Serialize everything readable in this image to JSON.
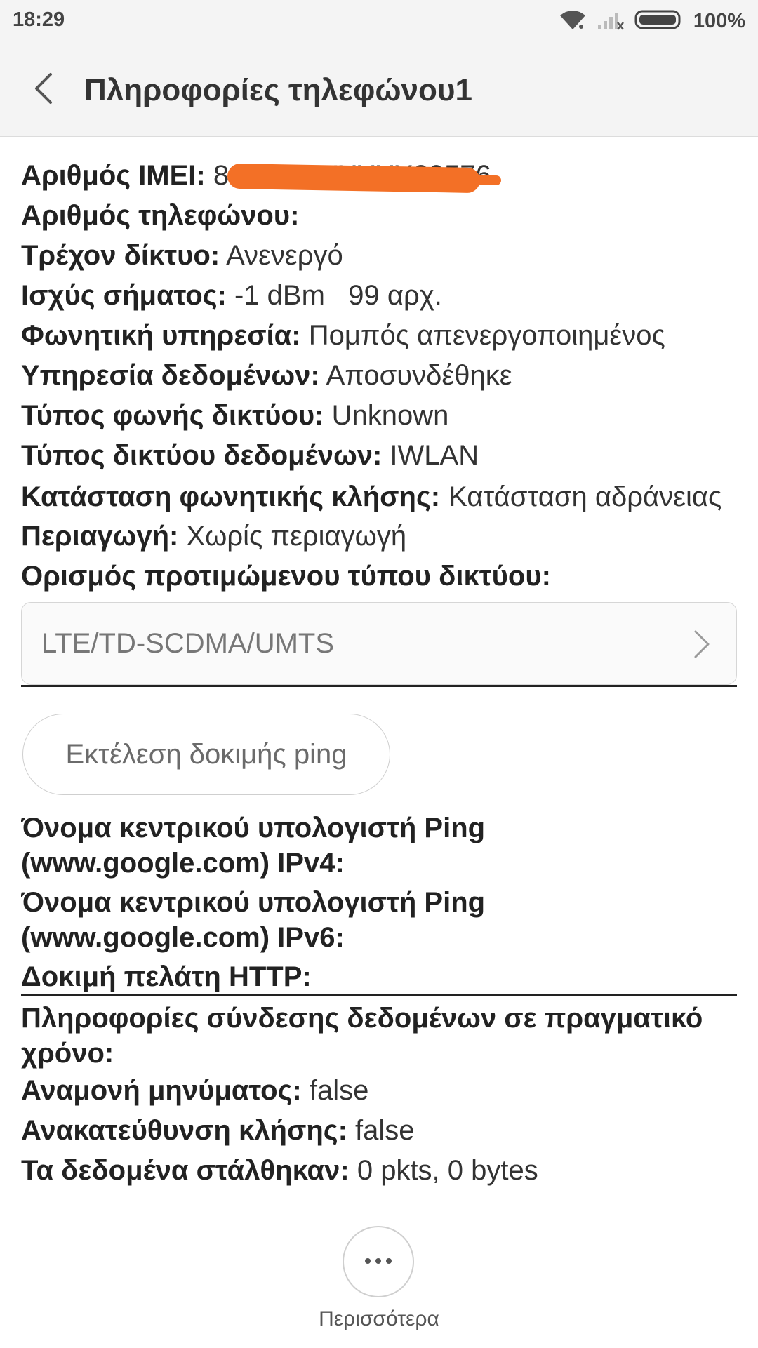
{
  "status_bar": {
    "time": "18:29",
    "battery": "100%",
    "icons": [
      "wifi-icon",
      "signal-icon",
      "battery-icon"
    ]
  },
  "header": {
    "title": "Πληροφορίες τηλεφώνου1",
    "back_icon": "chevron-left-icon"
  },
  "info": {
    "imei": {
      "label": "Αριθμός IMEI:",
      "value": "86XXXXXXXXX29576"
    },
    "phone_number": {
      "label": "Αριθμός τηλεφώνου:",
      "value": ""
    },
    "current_network": {
      "label": "Τρέχον δίκτυο:",
      "value": "Ανενεργό"
    },
    "signal_strength": {
      "label": "Ισχύς σήματος:",
      "value": "-1 dBm   99 αρχ."
    },
    "voice_service": {
      "label": "Φωνητική υπηρεσία:",
      "value": "Πομπός απενεργοποιημένος"
    },
    "data_service": {
      "label": "Υπηρεσία δεδομένων:",
      "value": "Αποσυνδέθηκε"
    },
    "voice_network_type": {
      "label": "Τύπος φωνής δικτύου:",
      "value": "Unknown"
    },
    "data_network_type": {
      "label": "Τύπος δικτύου δεδομένων:",
      "value": "IWLAN"
    },
    "voice_call_status": {
      "label": "Κατάσταση φωνητικής κλήσης:",
      "value": "Κατάσταση αδράνειας"
    },
    "roaming": {
      "label": "Περιαγωγή:",
      "value": "Χωρίς περιαγωγή"
    },
    "preferred_network": {
      "label": "Ορισμός προτιμώμενου τύπου δικτύου:"
    }
  },
  "network_select": {
    "value": "LTE/TD-SCDMA/UMTS"
  },
  "ping": {
    "button_label": "Εκτέλεση δοκιμής ping",
    "ipv4_label": "Όνομα κεντρικού υπολογιστή Ping (www.google.com) IPv4:",
    "ipv6_label": "Όνομα κεντρικού υπολογιστή Ping (www.google.com) IPv6:",
    "http_label": "Δοκιμή πελάτη HTTP:"
  },
  "realtime": {
    "title": "Πληροφορίες σύνδεσης δεδομένων σε πραγματικό χρόνο:",
    "message_waiting": {
      "label": "Αναμονή μηνύματος:",
      "value": "false"
    },
    "call_forwarding": {
      "label": "Ανακατεύθυνση κλήσης:",
      "value": "false"
    },
    "data_sent": {
      "label": "Τα δεδομένα στάλθηκαν:",
      "value": "0 pkts, 0 bytes"
    }
  },
  "bottom": {
    "more_label": "Περισσότερα",
    "more_icon": "more-dots-icon"
  },
  "colors": {
    "redaction": "#f37026",
    "header_bg": "#f4f4f4"
  }
}
